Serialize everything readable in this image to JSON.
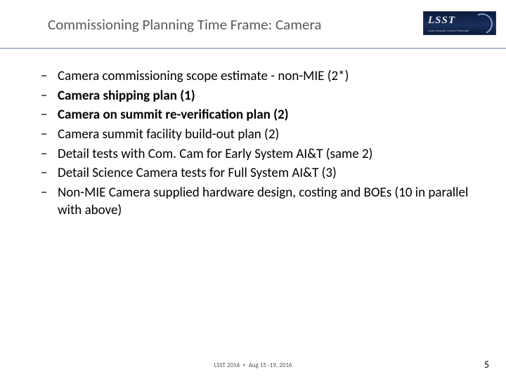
{
  "header": {
    "title": "Commissioning Planning Time Frame: Camera",
    "logo_text": "LSST",
    "logo_sub": "Large Synoptic Survey Telescope"
  },
  "bullets": [
    {
      "text": "Camera commissioning scope estimate - non-MIE (2*)",
      "bold": false
    },
    {
      "text": "Camera shipping plan (1)",
      "bold": true
    },
    {
      "text": "Camera on summit  re-verification plan (2)",
      "bold": true
    },
    {
      "text": "Camera summit facility build-out plan (2)",
      "bold": false
    },
    {
      "text": "Detail tests with Com. Cam for Early System AI&T (same 2)",
      "bold": false
    },
    {
      "text": "Detail Science Camera tests for Full System AI&T (3)",
      "bold": false
    },
    {
      "text": "Non-MIE Camera supplied hardware design, costing and BOEs (10 in parallel with above)",
      "bold": false
    }
  ],
  "footer": {
    "left": "LSST 2016",
    "right": "Aug 15 -19, 2016"
  },
  "page_number": "5"
}
